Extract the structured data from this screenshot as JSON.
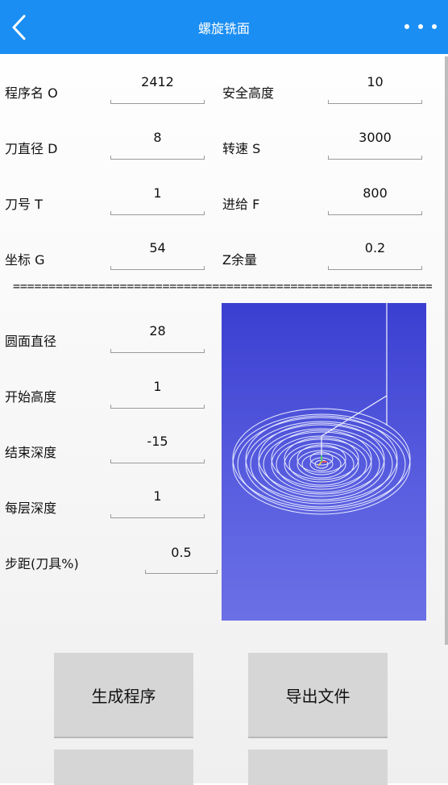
{
  "header": {
    "title": "螺旋铣面",
    "back_icon": "chevron-left-icon",
    "menu_icon": "more-horizontal-icon",
    "accent_color": "#1a8ef3"
  },
  "params_left": [
    {
      "label": "程序名 O",
      "value": "2412"
    },
    {
      "label": "刀直径 D",
      "value": "8"
    },
    {
      "label": "刀号 T",
      "value": "1"
    },
    {
      "label": "坐标 G",
      "value": "54"
    }
  ],
  "params_right": [
    {
      "label": "安全高度",
      "value": "10"
    },
    {
      "label": "转速 S",
      "value": "3000"
    },
    {
      "label": "进给 F",
      "value": "800"
    },
    {
      "label": "Z余量",
      "value": "0.2"
    }
  ],
  "divider": "================================================================",
  "spiral_params": [
    {
      "label": "圆面直径",
      "value": "28"
    },
    {
      "label": "开始高度",
      "value": "1"
    },
    {
      "label": "结束深度",
      "value": "-15"
    },
    {
      "label": "每层深度",
      "value": "1"
    },
    {
      "label": "步距(刀具%)",
      "value": "0.5"
    }
  ],
  "buttons": {
    "generate": "生成程序",
    "export": "导出文件"
  }
}
